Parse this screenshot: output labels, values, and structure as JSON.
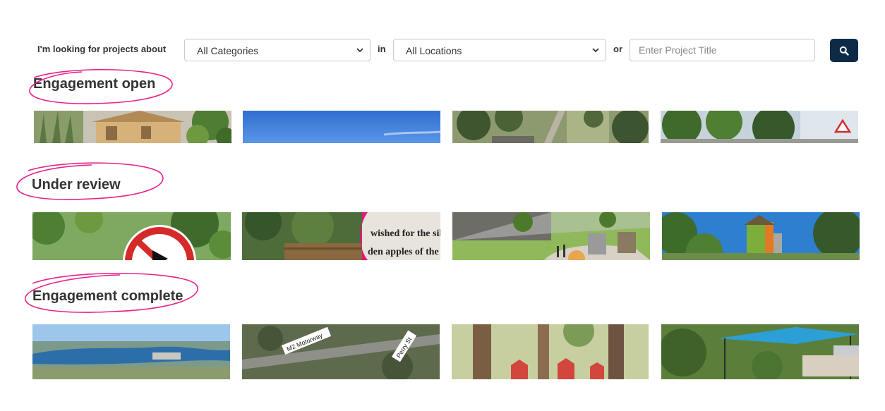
{
  "filter": {
    "intro_label": "I'm looking for projects about",
    "category_value": "All Categories",
    "in_label": "in",
    "location_value": "All Locations",
    "or_label": "or",
    "title_placeholder": "Enter Project Title",
    "search_icon": "search-icon"
  },
  "sections": [
    {
      "title": "Engagement open",
      "thumbnails": 4
    },
    {
      "title": "Under review",
      "thumbnails": 4
    },
    {
      "title": "Engagement complete",
      "thumbnails": 4
    }
  ],
  "image_text": {
    "sign_line1": "wished for the silver an",
    "sign_line2": "den apples of the moon",
    "map_label_1": "M2 Motorway",
    "map_label_2": "Perry St"
  },
  "colors": {
    "search_button": "#0d2b46",
    "annotation": "#e8238b"
  }
}
